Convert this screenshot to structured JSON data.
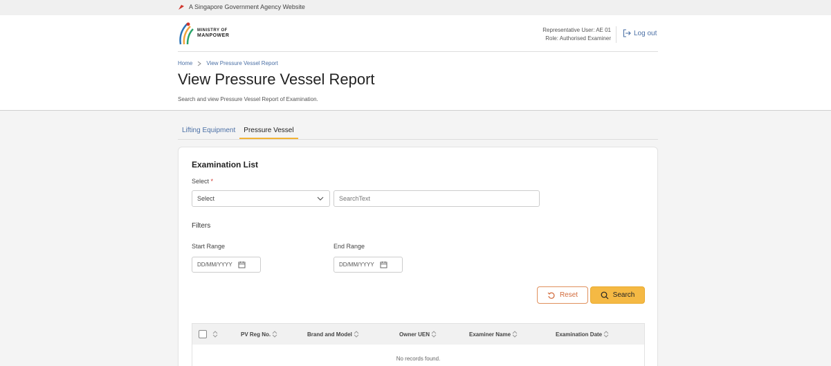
{
  "gov_banner": {
    "text": "A Singapore Government Agency Website"
  },
  "logo": {
    "line1": "MINISTRY OF",
    "line2": "MANPOWER"
  },
  "user": {
    "representative": "Representative User: AE 01",
    "role": "Role: Authorised Examiner"
  },
  "logout": {
    "label": "Log out"
  },
  "breadcrumb": {
    "home": "Home",
    "current": "View Pressure Vessel Report"
  },
  "page": {
    "title": "View Pressure Vessel Report",
    "subtitle": "Search and view Pressure Vessel Report of Examination."
  },
  "tabs": [
    {
      "label": "Lifting Equipment",
      "active": false
    },
    {
      "label": "Pressure Vessel",
      "active": true
    }
  ],
  "form": {
    "title": "Examination List",
    "select_label": "Select",
    "required_mark": "*",
    "select_value": "Select",
    "search_placeholder": "SearchText",
    "filters_label": "Filters",
    "start_label": "Start Range",
    "end_label": "End Range",
    "start_placeholder": "DD/MM/YYYY",
    "end_placeholder": "DD/MM/YYYY",
    "reset_label": "Reset",
    "search_label": "Search"
  },
  "table": {
    "columns": [
      "PV Reg No.",
      "Brand and Model",
      "Owner UEN",
      "Examiner Name",
      "Examination Date"
    ],
    "empty_text": "No records found."
  },
  "colors": {
    "accent": "#f5b944",
    "link": "#4a6fa5",
    "reset": "#d26a3a"
  }
}
